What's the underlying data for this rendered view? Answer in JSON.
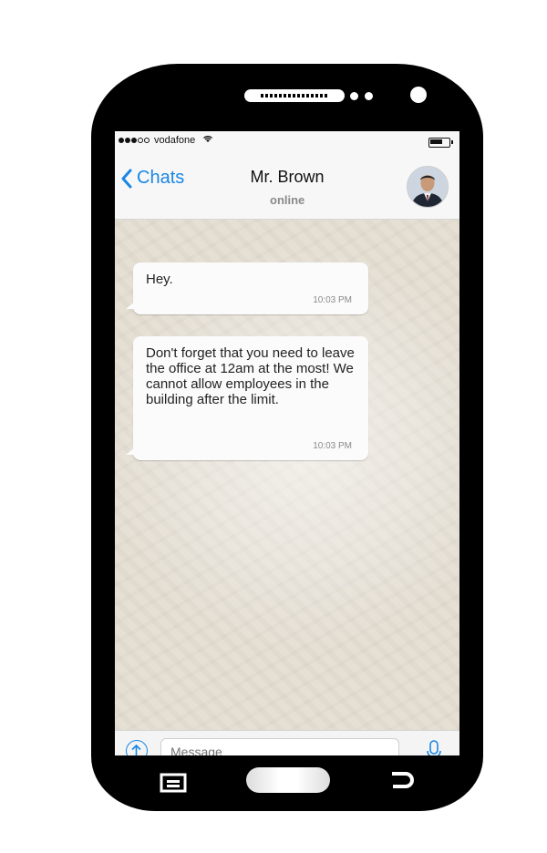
{
  "status_bar": {
    "carrier": "vodafone",
    "signal_bars": 3,
    "signal_total": 5,
    "battery_level": 0.7
  },
  "header": {
    "back_label": "Chats",
    "contact_name": "Mr. Brown",
    "contact_status": "online"
  },
  "messages": [
    {
      "text": "Hey.",
      "time": "10:03 PM"
    },
    {
      "text": "Don't forget that you need to leave the office at 12am at the most! We cannot allow employees in the building after the limit.",
      "time": "10:03 PM"
    }
  ],
  "composer": {
    "placeholder": "Message"
  },
  "colors": {
    "accent": "#1a86e5",
    "bubble": "#fbfbfb",
    "chat_background": "#e5dfd4",
    "phone_body": "#000000"
  },
  "icons": [
    "wifi-icon",
    "battery-icon",
    "chevron-left-icon",
    "upload-icon",
    "mic-icon",
    "menu-icon",
    "back-icon"
  ]
}
